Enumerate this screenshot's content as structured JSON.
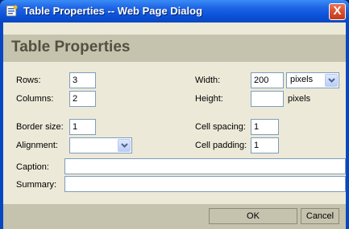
{
  "window": {
    "title": "Table Properties -- Web Page Dialog",
    "close_glyph": "X"
  },
  "header": {
    "title": "Table Properties"
  },
  "fields": {
    "rows": {
      "label": "Rows:",
      "value": "3"
    },
    "columns": {
      "label": "Columns:",
      "value": "2"
    },
    "width": {
      "label": "Width:",
      "value": "200",
      "unit_selected": "pixels"
    },
    "height": {
      "label": "Height:",
      "value": "",
      "unit": "pixels"
    },
    "border_size": {
      "label": "Border size:",
      "value": "1"
    },
    "alignment": {
      "label": "Alignment:",
      "selected": ""
    },
    "cell_spacing": {
      "label": "Cell spacing:",
      "value": "1"
    },
    "cell_padding": {
      "label": "Cell padding:",
      "value": "1"
    },
    "caption": {
      "label": "Caption:",
      "value": ""
    },
    "summary": {
      "label": "Summary:",
      "value": ""
    }
  },
  "buttons": {
    "ok": "OK",
    "cancel": "Cancel"
  },
  "icons": {
    "title": "page-icon",
    "dropdown": "chevron-down-icon"
  },
  "colors": {
    "titlebar": "#0a52d8",
    "header_band": "#c5c2ae",
    "client_bg": "#ece9d8",
    "close": "#d9502f"
  }
}
